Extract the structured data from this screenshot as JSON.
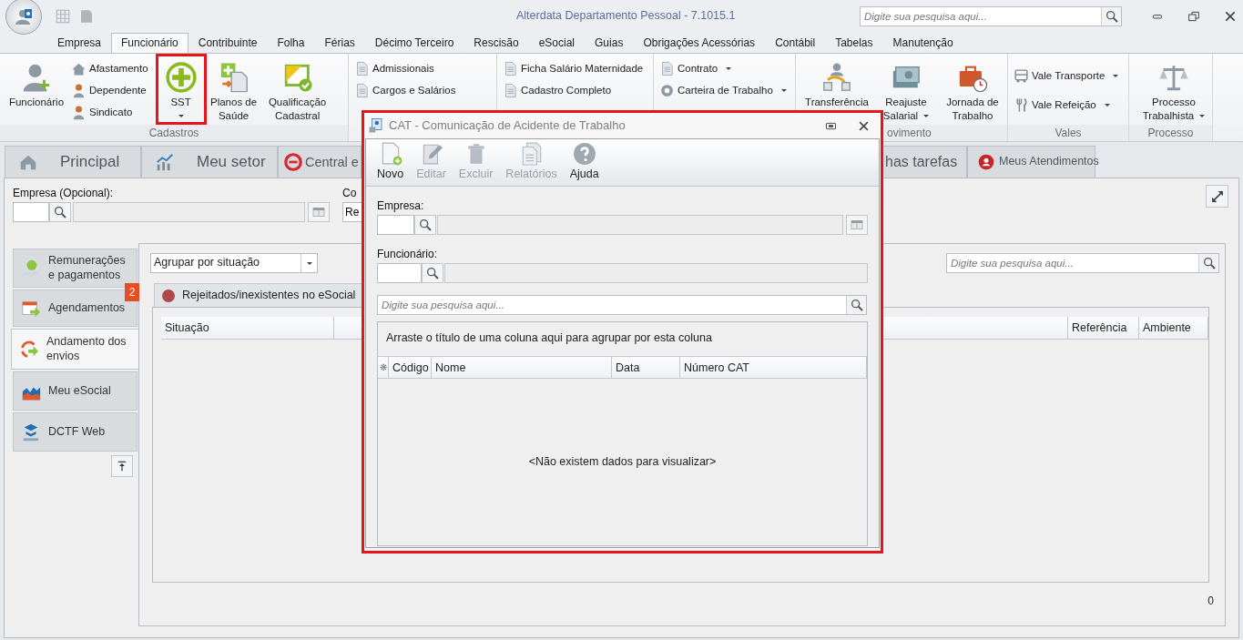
{
  "app": {
    "title": "Alterdata Departamento Pessoal - 7.1015.1",
    "search_placeholder": "Digite sua pesquisa aqui..."
  },
  "menu": [
    {
      "label": "Empresa",
      "selected": false
    },
    {
      "label": "Funcionário",
      "selected": true
    },
    {
      "label": "Contribuinte",
      "selected": false
    },
    {
      "label": "Folha",
      "selected": false
    },
    {
      "label": "Férias",
      "selected": false
    },
    {
      "label": "Décimo Terceiro",
      "selected": false
    },
    {
      "label": "Rescisão",
      "selected": false
    },
    {
      "label": "eSocial",
      "selected": false
    },
    {
      "label": "Guias",
      "selected": false
    },
    {
      "label": "Obrigações Acessórias",
      "selected": false
    },
    {
      "label": "Contábil",
      "selected": false
    },
    {
      "label": "Tabelas",
      "selected": false
    },
    {
      "label": "Manutenção",
      "selected": false
    }
  ],
  "ribbon": [
    {
      "label": "Cadastros",
      "items": [
        {
          "kind": "large",
          "label": "Funcionário",
          "dropdown": false,
          "highlighted": false
        },
        {
          "kind": "stack",
          "items": [
            {
              "label": "Afastamento",
              "dropdown": false
            },
            {
              "label": "Dependente",
              "dropdown": false
            },
            {
              "label": "Sindicato",
              "dropdown": false
            }
          ]
        },
        {
          "kind": "large",
          "label": "SST",
          "dropdown": true,
          "highlighted": true
        },
        {
          "kind": "large",
          "label": "Planos de Saúde",
          "dropdown": false,
          "highlighted": false
        },
        {
          "kind": "large",
          "label": "Qualificação Cadastral",
          "dropdown": false,
          "highlighted": false
        }
      ]
    },
    {
      "items": [
        {
          "kind": "stack",
          "items": [
            {
              "label": "Admissionais",
              "dropdown": false
            },
            {
              "label": "Cargos e Salários",
              "dropdown": false
            }
          ]
        }
      ]
    },
    {
      "items": [
        {
          "kind": "stack",
          "items": [
            {
              "label": "Ficha Salário Maternidade",
              "dropdown": false
            },
            {
              "label": "Cadastro Completo",
              "dropdown": false
            }
          ]
        }
      ]
    },
    {
      "items": [
        {
          "kind": "stack",
          "items": [
            {
              "label": "Contrato",
              "dropdown": true
            },
            {
              "label": "Carteira de Trabalho",
              "dropdown": true
            }
          ]
        }
      ]
    },
    {
      "label": "ovimento",
      "items": [
        {
          "kind": "large",
          "label": "Transferência",
          "highlighted": false
        },
        {
          "kind": "large",
          "label": "Reajuste Salarial",
          "dropdown": true,
          "highlighted": false
        },
        {
          "kind": "large",
          "label": "Jornada de Trabalho",
          "dropdown": false,
          "highlighted": false
        }
      ]
    },
    {
      "label": "Vales",
      "items": [
        {
          "kind": "stack",
          "items": [
            {
              "label": "Vale Transporte",
              "dropdown": true
            },
            {
              "label": "Vale Refeição",
              "dropdown": true
            }
          ]
        }
      ]
    },
    {
      "label": "Processo",
      "items": [
        {
          "kind": "large",
          "label": "Processo Trabalhista",
          "dropdown": true,
          "highlighted": false
        }
      ]
    }
  ],
  "doc_tabs": [
    {
      "label": "Principal"
    },
    {
      "label": "Meu setor"
    },
    {
      "label": "Central e"
    },
    {
      "label": "has tarefas"
    },
    {
      "label": "Meus Atendimentos"
    }
  ],
  "filter": {
    "company_label": "Empresa (Opcional):",
    "field_2_label": "Co",
    "field_2_value": "Re"
  },
  "side_nav": [
    {
      "label": "Remunerações e pagamentos",
      "selected": false
    },
    {
      "label": "Agendamentos",
      "selected": false,
      "badge": "2"
    },
    {
      "label": "Andamento dos envios",
      "selected": true
    },
    {
      "label": "Meu eSocial",
      "selected": false
    },
    {
      "label": "DCTF Web",
      "selected": false
    }
  ],
  "panel": {
    "group_by": "Agrupar por situação",
    "search_placeholder": "Digite sua pesquisa aqui...",
    "tabs": [
      {
        "label": "Rejeitados/inexistentes no eSocial"
      }
    ],
    "columns": [
      "Situação",
      "Referência",
      "Ambiente"
    ],
    "count": "0"
  },
  "dialog": {
    "title": "CAT - Comunicação de Acidente de Trabalho",
    "highlighted": true,
    "toolbar": [
      {
        "label": "Novo",
        "disabled": false
      },
      {
        "label": "Editar",
        "disabled": true
      },
      {
        "label": "Excluir",
        "disabled": true
      },
      {
        "label": "Relatórios",
        "disabled": true
      },
      {
        "label": "Ajuda",
        "disabled": false
      }
    ],
    "company_label": "Empresa:",
    "employee_label": "Funcionário:",
    "search_placeholder": "Digite sua pesquisa aqui...",
    "group_hint": "Arraste o título de uma coluna aqui para agrupar por esta coluna",
    "columns": [
      "❋",
      "Código",
      "Nome",
      "Data",
      "Número CAT"
    ],
    "empty_message": "<Não existem dados para visualizar>"
  }
}
